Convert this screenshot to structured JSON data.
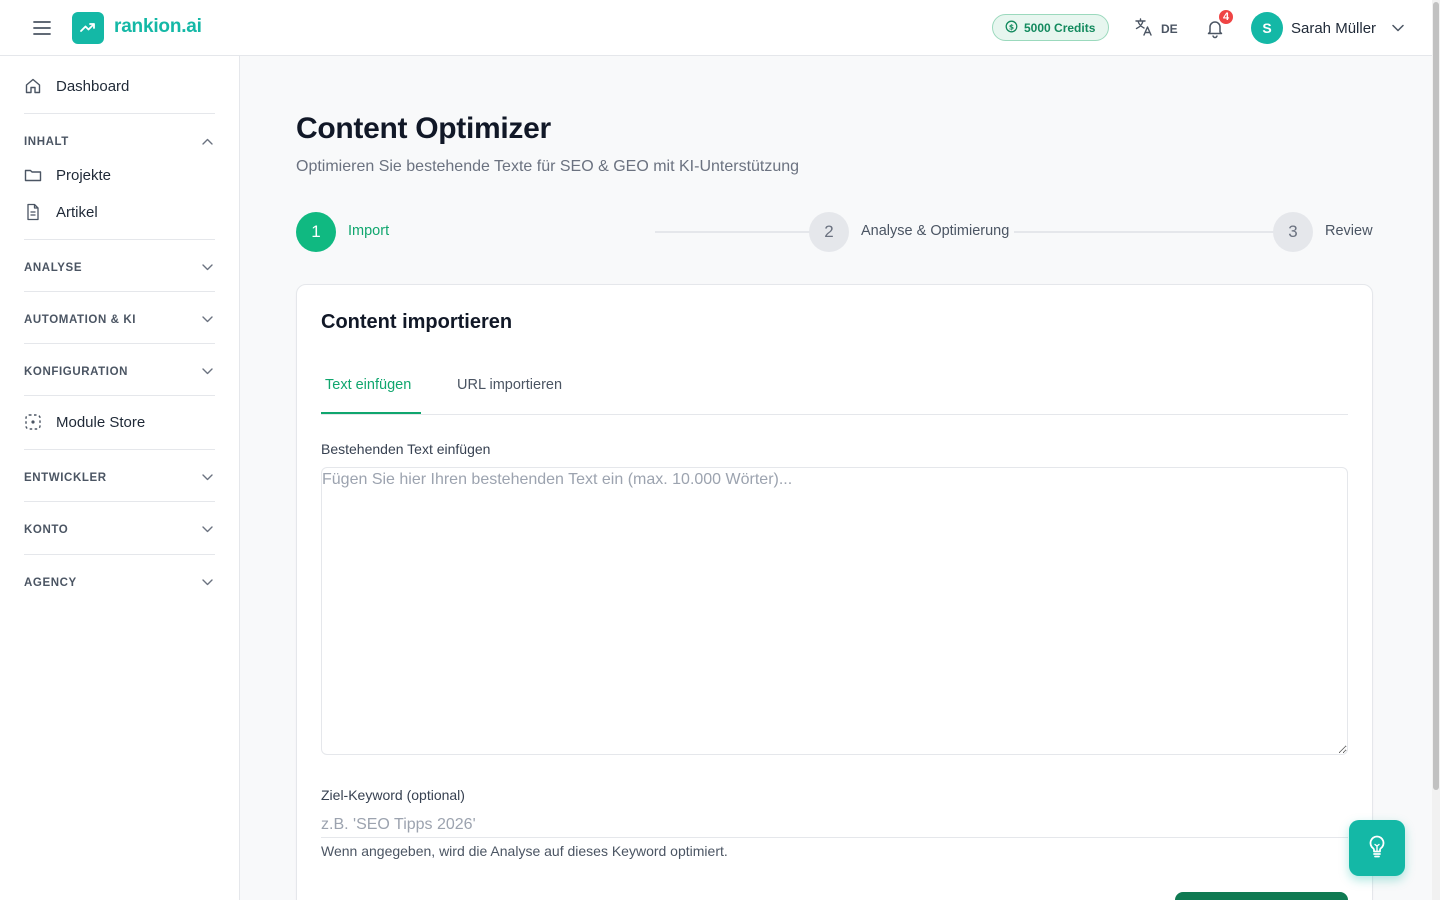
{
  "app": {
    "name": "rankion.ai"
  },
  "header": {
    "credits": "5000 Credits",
    "language": "DE",
    "notifications_count": "4",
    "user": {
      "initial": "S",
      "name": "Sarah Müller"
    }
  },
  "sidebar": {
    "dashboard": "Dashboard",
    "inhalt": {
      "label": "INHALT",
      "items": [
        "Projekte",
        "Artikel"
      ]
    },
    "analyse": "ANALYSE",
    "automation": "AUTOMATION & KI",
    "konfiguration": "KONFIGURATION",
    "module_store": "Module Store",
    "entwickler": "ENTWICKLER",
    "konto": "KONTO",
    "agency": "AGENCY"
  },
  "page": {
    "title": "Content Optimizer",
    "subtitle": "Optimieren Sie bestehende Texte für SEO & GEO mit KI-Unterstützung"
  },
  "stepper": [
    {
      "number": "1",
      "label": "Import",
      "state": "active"
    },
    {
      "number": "2",
      "label": "Analyse & Optimierung",
      "state": "inactive"
    },
    {
      "number": "3",
      "label": "Review",
      "state": "inactive"
    }
  ],
  "card": {
    "title": "Content importieren",
    "tabs": [
      {
        "label": "Text einfügen",
        "active": true
      },
      {
        "label": "URL importieren",
        "active": false
      }
    ],
    "text_field": {
      "label": "Bestehenden Text einfügen",
      "placeholder": "Fügen Sie hier Ihren bestehenden Text ein (max. 10.000 Wörter)...",
      "value": ""
    },
    "keyword_field": {
      "label": "Ziel-Keyword (optional)",
      "placeholder": "z.B. 'SEO Tipps 2026'",
      "value": "",
      "hint": "Wenn angegeben, wird die Analyse auf dieses Keyword optimiert."
    }
  },
  "colors": {
    "brand": "#14b8a6",
    "accent_green": "#10a66e",
    "primary_button": "#0f7a52"
  },
  "icons": {
    "menu": "hamburger-menu-icon",
    "logo": "trending-up-icon",
    "credits": "coin-icon",
    "language": "translate-icon",
    "notifications": "bell-icon",
    "user_menu": "chevron-down-icon",
    "dashboard": "home-icon",
    "projects": "folder-icon",
    "articles": "document-icon",
    "module_store": "dashed-box-icon",
    "fab": "lightbulb-icon"
  }
}
